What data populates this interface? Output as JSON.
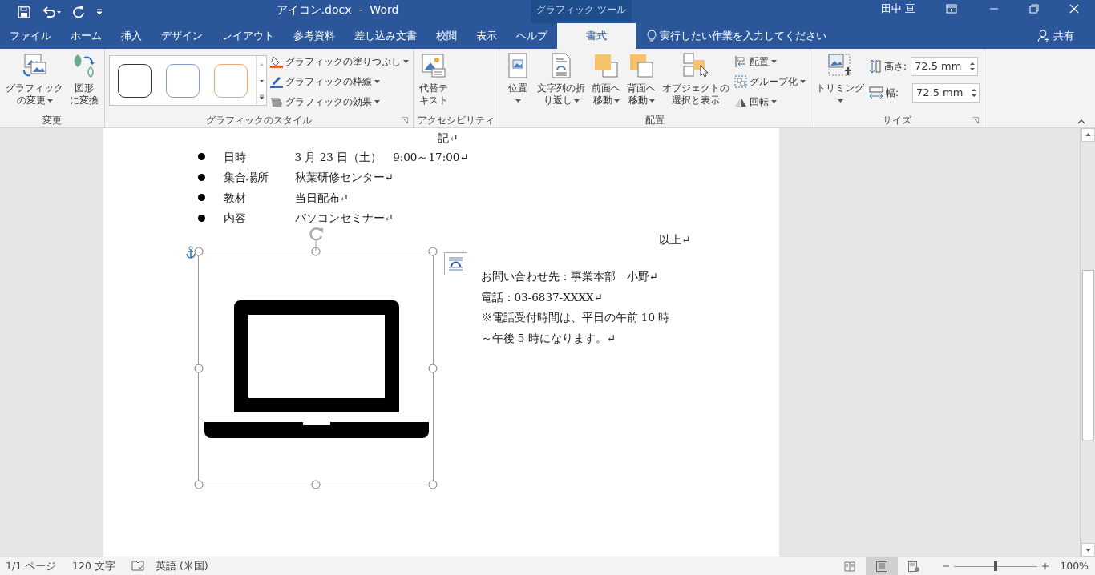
{
  "title_bar": {
    "title": "アイコン.docx  -  Word",
    "context_tab": "グラフィック ツール",
    "user": "田中 亘"
  },
  "tabs": [
    {
      "label": "ファイル",
      "selected": false
    },
    {
      "label": "ホーム",
      "selected": false
    },
    {
      "label": "挿入",
      "selected": false
    },
    {
      "label": "デザイン",
      "selected": false
    },
    {
      "label": "レイアウト",
      "selected": false
    },
    {
      "label": "参考資料",
      "selected": false
    },
    {
      "label": "差し込み文書",
      "selected": false
    },
    {
      "label": "校閲",
      "selected": false
    },
    {
      "label": "表示",
      "selected": false
    },
    {
      "label": "ヘルプ",
      "selected": false
    },
    {
      "label": "書式",
      "selected": true
    }
  ],
  "tell_me": {
    "placeholder": "実行したい作業を入力してください"
  },
  "share": "共有",
  "ribbon": {
    "groups": [
      {
        "label": "変更",
        "launcher": false,
        "items": [
          {
            "kind": "large",
            "lines": [
              "グラフィック",
              "の変更"
            ],
            "dropdown": true
          },
          {
            "kind": "large",
            "lines": [
              "図形",
              "に変換"
            ],
            "dropdown": false
          }
        ]
      },
      {
        "label": "グラフィックのスタイル",
        "launcher": true,
        "items": [
          {
            "kind": "gallery",
            "styles": [
              {
                "color": "#333333"
              },
              {
                "color": "#7f9bd0"
              },
              {
                "color": "#f2a46a"
              }
            ]
          },
          {
            "kind": "stack",
            "items": [
              {
                "label": "グラフィックの塗りつぶし",
                "dropdown": true
              },
              {
                "label": "グラフィックの枠線",
                "dropdown": true
              },
              {
                "label": "グラフィックの効果",
                "dropdown": true
              }
            ]
          }
        ]
      },
      {
        "label": "アクセシビリティ",
        "launcher": false,
        "items": [
          {
            "kind": "large",
            "lines": [
              "代替テ",
              "キスト"
            ],
            "dropdown": false
          }
        ]
      },
      {
        "label": "配置",
        "launcher": false,
        "items": [
          {
            "kind": "large",
            "lines": [
              "位置"
            ],
            "dropdown": true
          },
          {
            "kind": "large",
            "lines": [
              "文字列の折",
              "り返し"
            ],
            "dropdown": true
          },
          {
            "kind": "large",
            "lines": [
              "前面へ",
              "移動"
            ],
            "dropdown": true
          },
          {
            "kind": "large",
            "lines": [
              "背面へ",
              "移動"
            ],
            "dropdown": true
          },
          {
            "kind": "large",
            "lines": [
              "オブジェクトの",
              "選択と表示"
            ],
            "dropdown": false
          },
          {
            "kind": "stack",
            "items": [
              {
                "label": "配置",
                "dropdown": true
              },
              {
                "label": "グループ化",
                "dropdown": true
              },
              {
                "label": "回転",
                "dropdown": true
              }
            ]
          }
        ]
      },
      {
        "label": "サイズ",
        "launcher": true,
        "items": [
          {
            "kind": "large",
            "lines": [
              "トリミング"
            ],
            "dropdown": true
          },
          {
            "kind": "fields",
            "items": [
              {
                "label": "高さ:",
                "value": "72.5 mm"
              },
              {
                "label": "幅:",
                "value": "72.5 mm"
              }
            ]
          }
        ]
      }
    ]
  },
  "document": {
    "heading": "記↵",
    "items": [
      {
        "label": "日時",
        "value": "3 月 23 日（土）　9:00～17:00↵"
      },
      {
        "label": "集合場所",
        "value": "秋葉研修センター↵"
      },
      {
        "label": "教材",
        "value": "当日配布↵"
      },
      {
        "label": "内容",
        "value": "パソコンセミナー↵"
      }
    ],
    "closing": "以上↵",
    "contact": [
      "お問い合わせ先：事業本部　小野↵",
      "電話：03-6837-XXXX↵",
      "※電話受付時間は、平日の午前 10 時",
      "～午後 5 時になります。↵"
    ]
  },
  "status_bar": {
    "page": "1/1 ページ",
    "words": "120 文字",
    "language": "英語 (米国)",
    "views": [
      {
        "selected": false
      },
      {
        "selected": true
      },
      {
        "selected": false
      }
    ],
    "zoom": {
      "level": 0.5,
      "label": "100%"
    }
  }
}
